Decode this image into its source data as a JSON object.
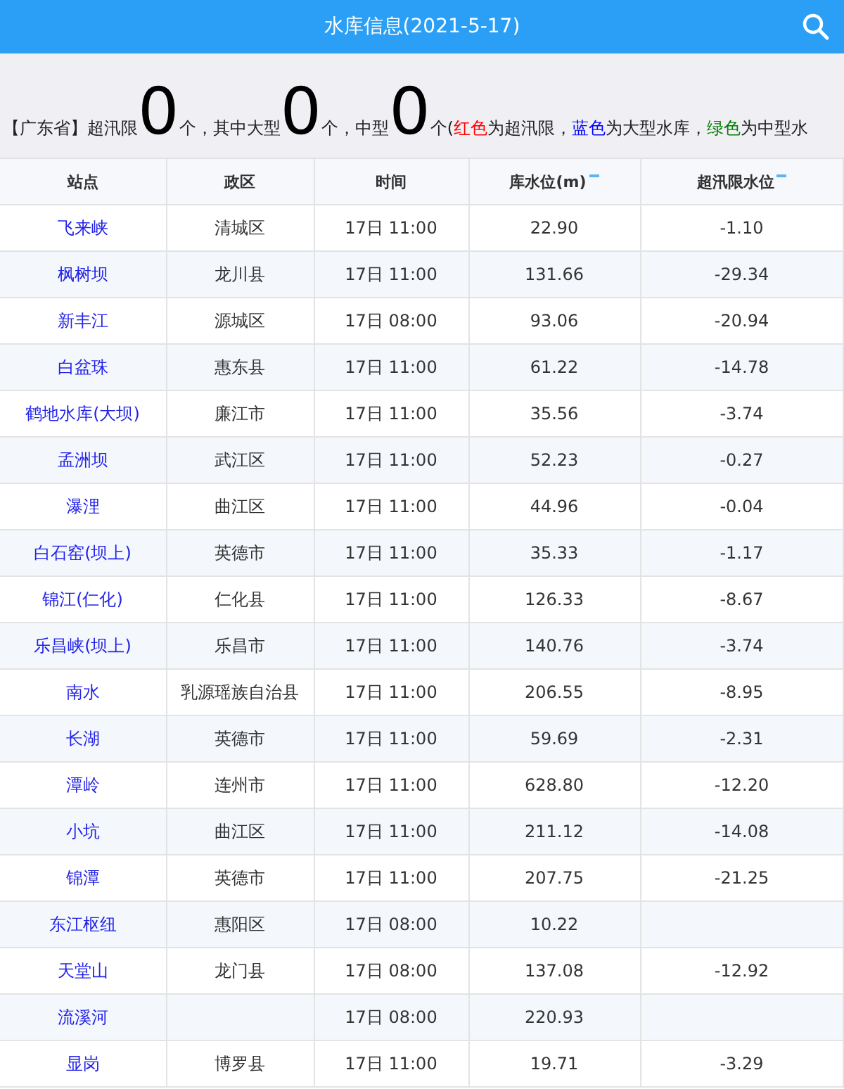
{
  "header": {
    "title": "水库信息(2021-5-17)"
  },
  "summary": [
    {
      "kind": "text",
      "text": "【广东省】超汛限"
    },
    {
      "kind": "count",
      "text": "0"
    },
    {
      "kind": "text",
      "text": "个，其中大型"
    },
    {
      "kind": "count",
      "text": "0"
    },
    {
      "kind": "text",
      "text": "个，中型"
    },
    {
      "kind": "count",
      "text": "0"
    },
    {
      "kind": "text",
      "text": "个("
    },
    {
      "kind": "legend",
      "text": "红色",
      "color": "#ff0000"
    },
    {
      "kind": "text",
      "text": "为超汛限，"
    },
    {
      "kind": "legend",
      "text": "蓝色",
      "color": "#0000ff"
    },
    {
      "kind": "text",
      "text": "为大型水库，"
    },
    {
      "kind": "legend",
      "text": "绿色",
      "color": "#008000"
    },
    {
      "kind": "text",
      "text": "为中型水"
    }
  ],
  "table": {
    "columns": [
      {
        "label": "站点",
        "sortable": false
      },
      {
        "label": "政区",
        "sortable": false
      },
      {
        "label": "时间",
        "sortable": false
      },
      {
        "label": "库水位(m)",
        "sortable": true
      },
      {
        "label": "超汛限水位",
        "sortable": true
      }
    ],
    "rows": [
      [
        "飞来峡",
        "清城区",
        "17日 11:00",
        "22.90",
        "-1.10"
      ],
      [
        "枫树坝",
        "龙川县",
        "17日 11:00",
        "131.66",
        "-29.34"
      ],
      [
        "新丰江",
        "源城区",
        "17日 08:00",
        "93.06",
        "-20.94"
      ],
      [
        "白盆珠",
        "惠东县",
        "17日 11:00",
        "61.22",
        "-14.78"
      ],
      [
        "鹤地水库(大坝)",
        "廉江市",
        "17日 11:00",
        "35.56",
        "-3.74"
      ],
      [
        "孟洲坝",
        "武江区",
        "17日 11:00",
        "52.23",
        "-0.27"
      ],
      [
        "瀑浬",
        "曲江区",
        "17日 11:00",
        "44.96",
        "-0.04"
      ],
      [
        "白石窑(坝上)",
        "英德市",
        "17日 11:00",
        "35.33",
        "-1.17"
      ],
      [
        "锦江(仁化)",
        "仁化县",
        "17日 11:00",
        "126.33",
        "-8.67"
      ],
      [
        "乐昌峡(坝上)",
        "乐昌市",
        "17日 11:00",
        "140.76",
        "-3.74"
      ],
      [
        "南水",
        "乳源瑶族自治县",
        "17日 11:00",
        "206.55",
        "-8.95"
      ],
      [
        "长湖",
        "英德市",
        "17日 11:00",
        "59.69",
        "-2.31"
      ],
      [
        "潭岭",
        "连州市",
        "17日 11:00",
        "628.80",
        "-12.20"
      ],
      [
        "小坑",
        "曲江区",
        "17日 11:00",
        "211.12",
        "-14.08"
      ],
      [
        "锦潭",
        "英德市",
        "17日 11:00",
        "207.75",
        "-21.25"
      ],
      [
        "东江枢纽",
        "惠阳区",
        "17日 08:00",
        "10.22",
        null
      ],
      [
        "天堂山",
        "龙门县",
        "17日 08:00",
        "137.08",
        "-12.92"
      ],
      [
        "流溪河",
        null,
        "17日 08:00",
        "220.93",
        null
      ],
      [
        "显岗",
        "博罗县",
        "17日 11:00",
        "19.71",
        "-3.29"
      ]
    ]
  }
}
